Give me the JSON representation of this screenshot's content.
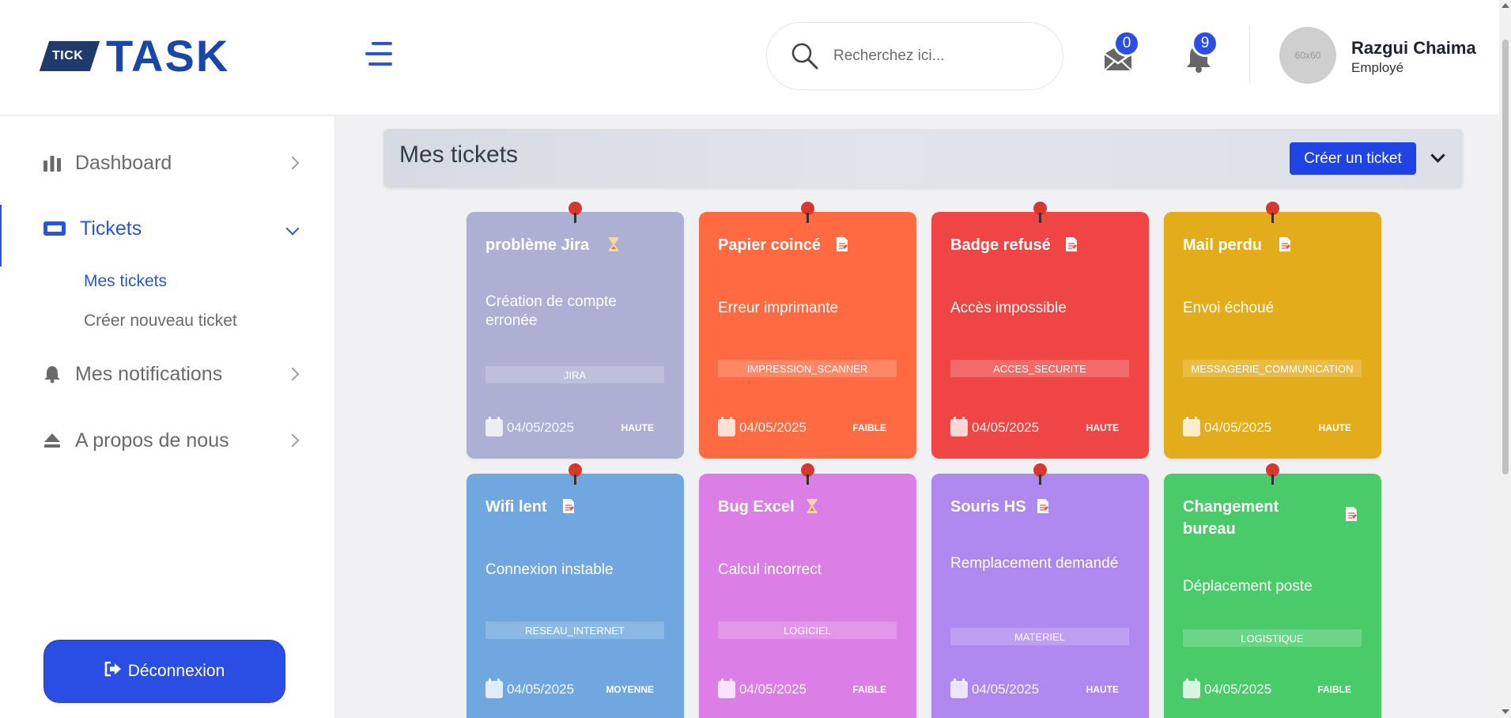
{
  "logo": {
    "badge": "TICK",
    "main": "TASK"
  },
  "search": {
    "placeholder": "Recherchez ici..."
  },
  "notifications": {
    "mail_count": "0",
    "bell_count": "9"
  },
  "user": {
    "avatar_text": "60x60",
    "name": "Razgui Chaima",
    "role": "Employé"
  },
  "sidebar": {
    "items": [
      {
        "label": "Dashboard",
        "icon": "bar-chart-icon"
      },
      {
        "label": "Tickets",
        "icon": "ticket-icon"
      },
      {
        "label": "Mes notifications",
        "icon": "bell-icon"
      },
      {
        "label": "A propos de nous",
        "icon": "eject-icon"
      }
    ],
    "submenu": [
      "Mes tickets",
      "Créer nouveau ticket"
    ],
    "logout_label": "Déconnexion"
  },
  "main": {
    "title": "Mes tickets",
    "create_button": "Créer un ticket",
    "tickets": [
      {
        "title": "problème Jira",
        "status_icon": "hourglass-icon",
        "description": "Création de compte erronée",
        "category": "JIRA",
        "date": "04/05/2025",
        "priority": "HAUTE",
        "color": "#adb0d2"
      },
      {
        "title": "Papier coincé",
        "status_icon": "document-icon",
        "description": "Erreur imprimante",
        "category": "IMPRESSION_SCANNER",
        "date": "04/05/2025",
        "priority": "FAIBLE",
        "color": "#fe6a41"
      },
      {
        "title": "Badge refusé",
        "status_icon": "document-icon",
        "description": "Accès impossible",
        "category": "ACCES_SECURITE",
        "date": "04/05/2025",
        "priority": "HAUTE",
        "color": "#ef4545"
      },
      {
        "title": "Mail perdu",
        "status_icon": "document-icon",
        "description": "Envoi échoué",
        "category": "MESSAGERIE_COMMUNICATION",
        "date": "04/05/2025",
        "priority": "HAUTE",
        "color": "#e2ac1b"
      },
      {
        "title": "Wifi lent",
        "status_icon": "document-icon",
        "description": "Connexion instable",
        "category": "RESEAU_INTERNET",
        "date": "04/05/2025",
        "priority": "MOYENNE",
        "color": "#70a7de"
      },
      {
        "title": "Bug Excel",
        "status_icon": "hourglass-icon",
        "description": "Calcul incorrect",
        "category": "LOGICIEL",
        "date": "04/05/2025",
        "priority": "FAIBLE",
        "color": "#db7ee6"
      },
      {
        "title": "Souris HS",
        "status_icon": "document-icon",
        "description": "Remplacement demandé",
        "category": "MATERIEL",
        "date": "04/05/2025",
        "priority": "HAUTE",
        "color": "#ae87ef"
      },
      {
        "title": "Changement bureau",
        "status_icon": "document-icon",
        "description": "Déplacement poste",
        "category": "LOGISTIQUE",
        "date": "04/05/2025",
        "priority": "FAIBLE",
        "color": "#49cb6a"
      }
    ]
  }
}
